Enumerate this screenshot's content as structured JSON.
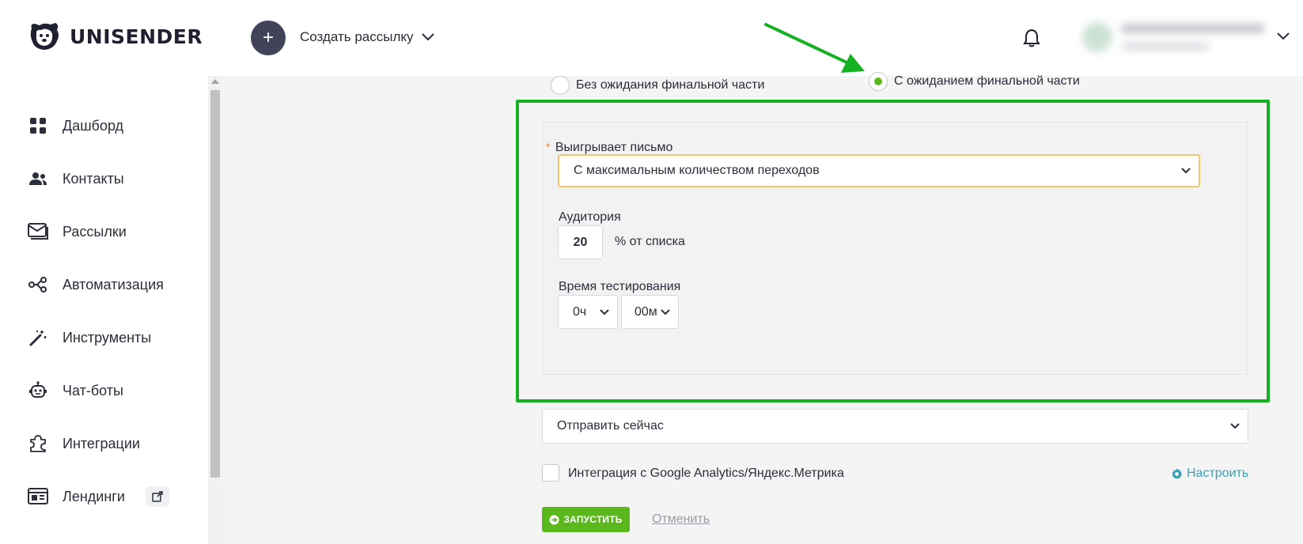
{
  "app": {
    "brand": "UNISENDER"
  },
  "header": {
    "create_label": "Создать рассылку",
    "plus_symbol": "+"
  },
  "sidebar": {
    "items": [
      {
        "label": "Дашборд",
        "icon": "dashboard-grid-icon"
      },
      {
        "label": "Контакты",
        "icon": "people-icon"
      },
      {
        "label": "Рассылки",
        "icon": "mail-stack-icon"
      },
      {
        "label": "Автоматизация",
        "icon": "share-nodes-icon"
      },
      {
        "label": "Инструменты",
        "icon": "magic-wand-icon"
      },
      {
        "label": "Чат-боты",
        "icon": "robot-icon"
      },
      {
        "label": "Интеграции",
        "icon": "puzzle-icon"
      },
      {
        "label": "Лендинги",
        "icon": "landing-page-icon",
        "badge_icon": "external-link-icon"
      }
    ]
  },
  "ab_test": {
    "mode_options": [
      {
        "label": "Без ожидания финальной части",
        "selected": false
      },
      {
        "label": "С ожиданием финальной части",
        "selected": true
      }
    ],
    "winner_label": "Выигрывает письмо",
    "winner_required_mark": "*",
    "winner_value": "С максимальным количеством переходов",
    "audience_label": "Аудитория",
    "audience_value": "20",
    "audience_suffix": "% от списка",
    "test_time_label": "Время тестирования",
    "hours_value": "0ч",
    "minutes_value": "00м"
  },
  "send": {
    "schedule_value": "Отправить сейчас",
    "analytics_label": "Интеграция с Google Analytics/Яндекс.Метрика",
    "analytics_checked": false,
    "configure_label": "Настроить",
    "launch_label": "ЗАПУСТИТЬ",
    "cancel_label": "Отменить"
  },
  "colors": {
    "accent_green": "#5bb81c",
    "highlight_frame": "#16b023",
    "link_blue": "#3b9fb4",
    "required_orange": "#f0962d",
    "dark_button": "#414459"
  }
}
